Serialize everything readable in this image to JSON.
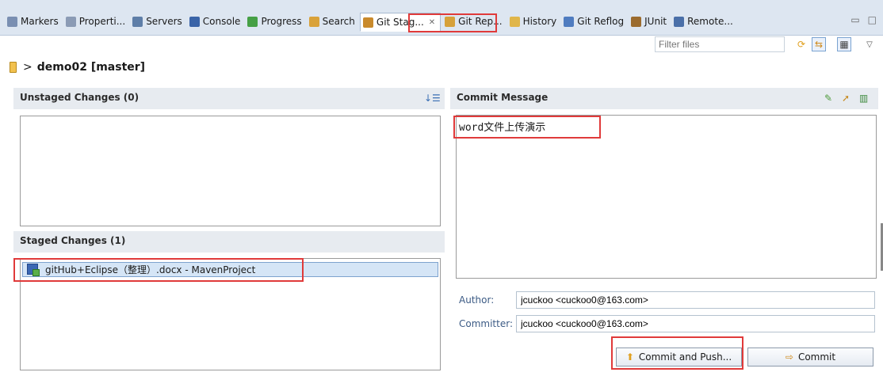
{
  "tabs": [
    {
      "label": "Markers",
      "icon": "markers-icon",
      "color": "#7a8fb2",
      "active": false
    },
    {
      "label": "Properti...",
      "icon": "properties-icon",
      "color": "#8b9bb5",
      "active": false
    },
    {
      "label": "Servers",
      "icon": "servers-icon",
      "color": "#5e7ea8",
      "active": false
    },
    {
      "label": "Console",
      "icon": "console-icon",
      "color": "#3a64a8",
      "active": false
    },
    {
      "label": "Progress",
      "icon": "progress-icon",
      "color": "#46a046",
      "active": false
    },
    {
      "label": "Search",
      "icon": "search-icon",
      "color": "#d9a23a",
      "active": false
    },
    {
      "label": "Git Stag...",
      "icon": "git-staging-icon",
      "color": "#c98a2c",
      "active": true
    },
    {
      "label": "Git Rep...",
      "icon": "git-repositories-icon",
      "color": "#d6a13a",
      "active": false
    },
    {
      "label": "History",
      "icon": "history-icon",
      "color": "#e0b64a",
      "active": false
    },
    {
      "label": "Git Reflog",
      "icon": "git-reflog-icon",
      "color": "#4f7cc0",
      "active": false
    },
    {
      "label": "JUnit",
      "icon": "junit-icon",
      "color": "#9b6b2e",
      "active": false
    },
    {
      "label": "Remote...",
      "icon": "remote-icon",
      "color": "#4a6fa8",
      "active": false
    }
  ],
  "filter": {
    "placeholder": "Filter files"
  },
  "repo": {
    "separator": ">",
    "name": "demo02 [master]"
  },
  "unstaged": {
    "title": "Unstaged Changes (0)"
  },
  "staged": {
    "title": "Staged Changes (1)",
    "files": [
      {
        "label": "gitHub+Eclipse（整理）.docx - MavenProject"
      }
    ]
  },
  "commit": {
    "title": "Commit Message",
    "message": "word文件上传演示",
    "author_label": "Author:",
    "author_value": "jcuckoo <cuckoo0@163.com>",
    "committer_label": "Committer:",
    "committer_value": "jcuckoo <cuckoo0@163.com>",
    "commit_and_push_label": "Commit and Push...",
    "commit_label": "Commit"
  },
  "colors": {
    "annotation": "#e03a3a",
    "header_bg": "#e7ebf0",
    "selection": "#d5e5f6"
  }
}
